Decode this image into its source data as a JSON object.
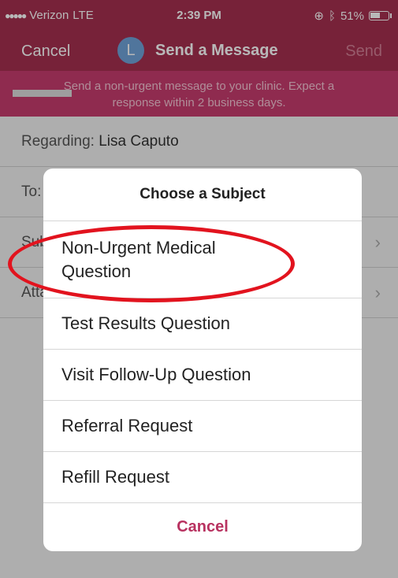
{
  "status": {
    "carrier": "Verizon",
    "network": "LTE",
    "time": "2:39 PM",
    "battery": "51%"
  },
  "nav": {
    "cancel_label": "Cancel",
    "avatar_initial": "L",
    "title": "Send a Message",
    "send_label": "Send"
  },
  "banner": {
    "line1": "Send a non-urgent message to your clinic. Expect a",
    "line2": "response within 2 business days."
  },
  "form": {
    "regarding_label": "Regarding:",
    "regarding_value": "Lisa Caputo",
    "to_label": "To:",
    "subject_label": "Subject:",
    "attach_label": "Attach"
  },
  "modal": {
    "title": "Choose a Subject",
    "options": [
      "Non-Urgent Medical\nQuestion",
      "Test Results Question",
      "Visit Follow-Up Question",
      "Referral Request",
      "Refill Request"
    ],
    "option_line1": "Non-Urgent Medical",
    "option_line2": "Question",
    "cancel_label": "Cancel"
  },
  "colors": {
    "brand": "#a6304f",
    "banner": "#c63c6e",
    "accent": "#b83260",
    "highlight": "#e2131e"
  }
}
